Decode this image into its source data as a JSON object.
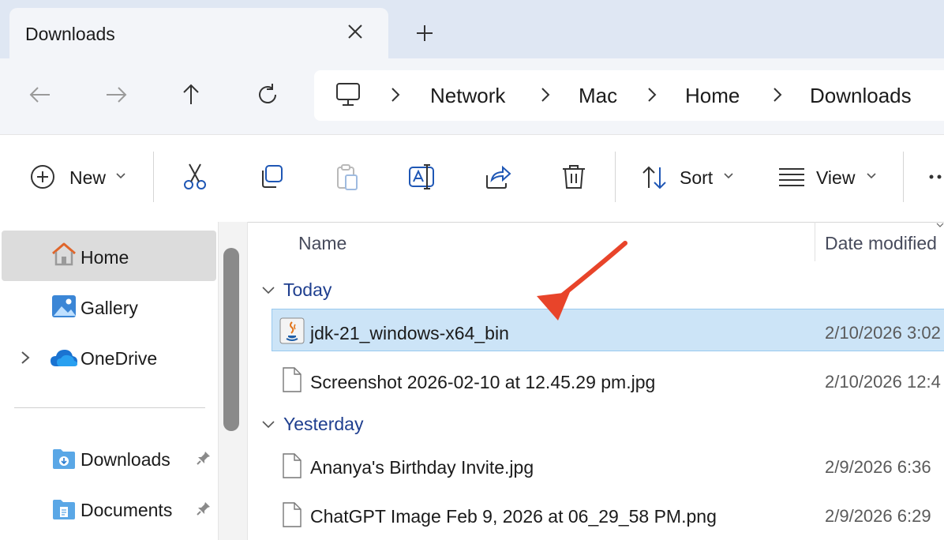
{
  "tab": {
    "title": "Downloads"
  },
  "breadcrumb": [
    "Network",
    "Mac",
    "Home",
    "Downloads"
  ],
  "toolbar": {
    "new_label": "New",
    "sort_label": "Sort",
    "view_label": "View"
  },
  "sidebar": {
    "home": "Home",
    "gallery": "Gallery",
    "onedrive": "OneDrive",
    "pinned": [
      {
        "label": "Downloads"
      },
      {
        "label": "Documents"
      }
    ]
  },
  "columns": {
    "name": "Name",
    "date": "Date modified"
  },
  "groups": [
    {
      "label": "Today",
      "files": [
        {
          "name": "jdk-21_windows-x64_bin",
          "date": "2/10/2026 3:02",
          "selected": true,
          "icon": "java-installer-icon"
        },
        {
          "name": "Screenshot 2026-02-10 at 12.45.29 pm.jpg",
          "date": "2/10/2026 12:4",
          "selected": false,
          "icon": "file-icon"
        }
      ]
    },
    {
      "label": "Yesterday",
      "files": [
        {
          "name": "Ananya's Birthday Invite.jpg",
          "date": "2/9/2026 6:36",
          "selected": false,
          "icon": "file-icon"
        },
        {
          "name": "ChatGPT Image Feb 9, 2026 at 06_29_58 PM.png",
          "date": "2/9/2026 6:29",
          "selected": false,
          "icon": "file-icon"
        }
      ]
    }
  ],
  "colors": {
    "selection": "#cce4f7",
    "group_label": "#1f3f8f",
    "annotation_arrow": "#e8442a"
  }
}
